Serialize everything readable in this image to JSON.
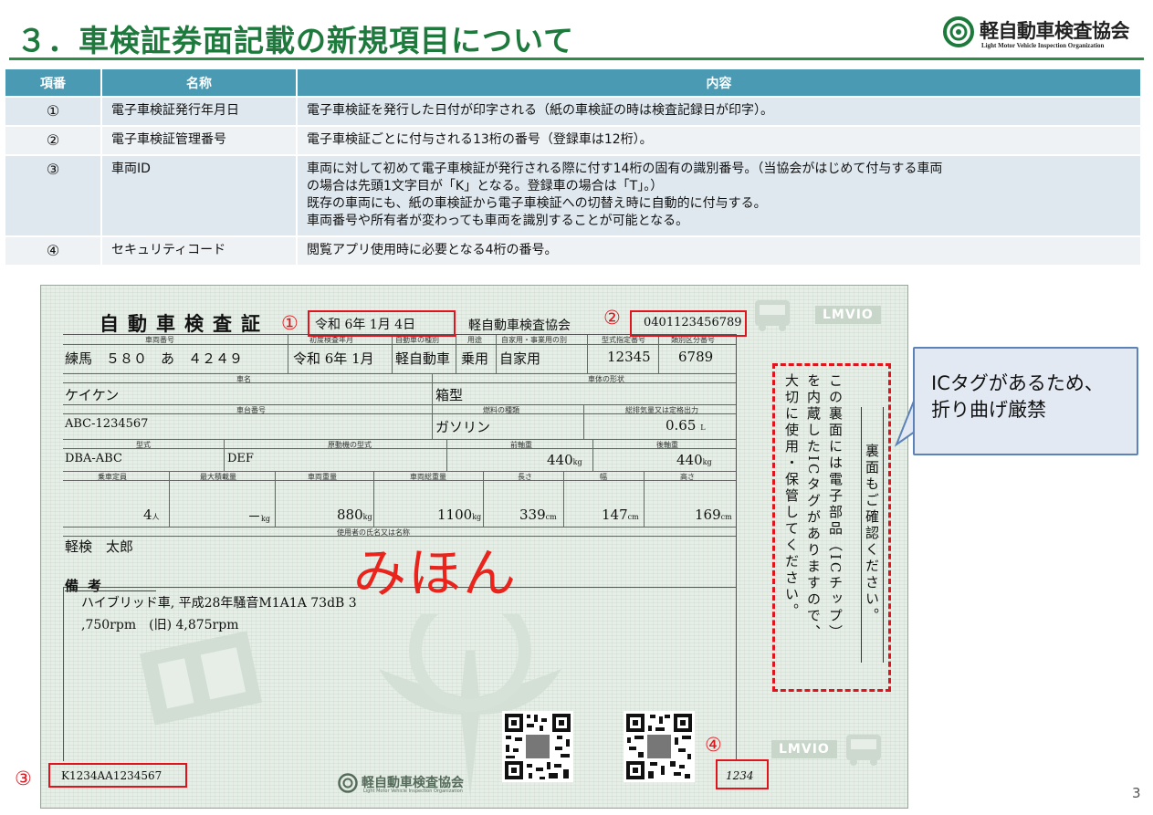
{
  "header": {
    "title": "３．車検証券面記載の新規項目について",
    "org_name": "軽自動車検査協会",
    "org_name_en": "Light Motor Vehicle Inspection Organization"
  },
  "table": {
    "headers": [
      "項番",
      "名称",
      "内容"
    ],
    "rows": [
      {
        "num": "①",
        "name": "電子車検証発行年月日",
        "content": [
          "電子車検証を発行した日付が印字される（紙の車検証の時は検査記録日が印字）。"
        ]
      },
      {
        "num": "②",
        "name": "電子車検証管理番号",
        "content": [
          "電子車検証ごとに付与される13桁の番号（登録車は12桁）。"
        ]
      },
      {
        "num": "③",
        "name": "車両ID",
        "content": [
          "車両に対して初めて電子車検証が発行される際に付す14桁の固有の識別番号。（当協会がはじめて付与する車両",
          "の場合は先頭1文字目が「K」となる。登録車の場合は「T」。）",
          "既存の車両にも、紙の車検証から電子車検証への切替え時に自動的に付与する。",
          "車両番号や所有者が変わっても車両を識別することが可能となる。"
        ]
      },
      {
        "num": "④",
        "name": "セキュリティコード",
        "content": [
          "閲覧アプリ使用時に必要となる4桁の番号。"
        ]
      }
    ]
  },
  "certificate": {
    "title": "自動車検査証",
    "issue_date": "令和 6年 1月 4日",
    "issuer": "軽自動車検査協会",
    "mgmt_number": "0401123456789",
    "labels": {
      "reg_number": "車両番号",
      "first_reg": "初度検査年月",
      "vehicle_kind": "自動車の種別",
      "use": "用途",
      "private_business": "自家用・事業用の別",
      "type_designation": "型式指定番号",
      "category_number": "類別区分番号",
      "car_name": "車名",
      "body_shape": "車体の形状",
      "chassis_number": "車台番号",
      "fuel": "燃料の種類",
      "displacement": "総排気量又は定格出力",
      "model": "型式",
      "engine_model": "原動機の型式",
      "front_axle": "前軸重",
      "rear_axle": "後軸重",
      "capacity": "乗車定員",
      "max_load": "最大積載量",
      "weight": "車両重量",
      "gross_weight": "車両総重量",
      "length": "長さ",
      "width": "幅",
      "height": "高さ",
      "user_name": "使用者の氏名又は名称",
      "remarks": "備考"
    },
    "values": {
      "reg_number": "練馬　５８０　あ　４２４９",
      "first_reg": "令和  6年 1月",
      "vehicle_kind": "軽自動車",
      "use": "乗用",
      "private_business": "自家用",
      "type_designation": "12345",
      "category_number": "6789",
      "car_name": "ケイケン",
      "body_shape": "箱型",
      "chassis_number": "ABC-1234567",
      "fuel": "ガソリン",
      "displacement": "0.65",
      "displacement_unit": "L",
      "model": "DBA-ABC",
      "engine_model": "DEF",
      "front_axle": "440",
      "rear_axle": "440",
      "axle_unit": "kg",
      "capacity": "4",
      "capacity_unit": "人",
      "max_load": "－",
      "weight": "880",
      "gross_weight": "1100",
      "kg_unit": "kg",
      "length": "339",
      "width": "147",
      "height": "169",
      "cm_unit": "cm",
      "user_name": "軽検　太郎",
      "remarks_lines": [
        "ハイブリッド車, 平成28年騒音M1A1A 73dB 3",
        ",750rpm　(旧) 4,875rpm"
      ],
      "vehicle_id": "K1234AA1234567",
      "security_code": "1234"
    },
    "sample_mark": "みほん",
    "lmvio": "LMVIO",
    "vertical_note": [
      "この裏面には電子部品（ICチップ）",
      "を内蔵したICタグがありますので、",
      "大切に使用・保管してください。"
    ],
    "vertical_box": "裏面もご確認ください。"
  },
  "markers": [
    "①",
    "②",
    "③",
    "④"
  ],
  "callout": {
    "lines": [
      "ICタグがあるため、",
      "折り曲げ厳禁"
    ]
  },
  "page_number": "3",
  "colors": {
    "title_green": "#1d7a3c",
    "table_header": "#4a9ab3",
    "marker_red": "#e0141c",
    "callout_border": "#5c82b7"
  }
}
